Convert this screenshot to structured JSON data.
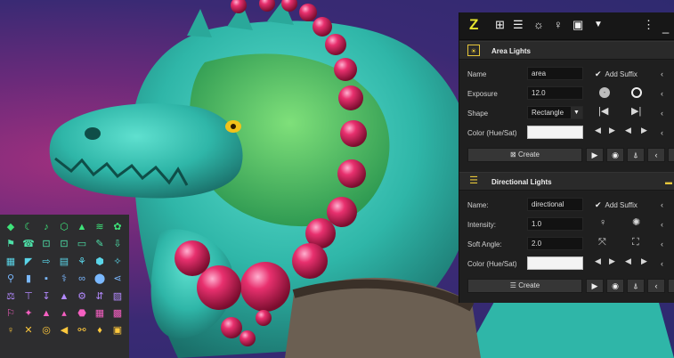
{
  "toolbar": {
    "logo": "Z",
    "icons": [
      "sun-box-icon",
      "list-stack-icon",
      "horizon-sun-icon",
      "bulb-icon",
      "film-icon",
      "chevron-down-icon",
      "more-vertical-icon",
      "minimize-icon"
    ]
  },
  "area": {
    "title": "Area Lights",
    "name_label": "Name",
    "name_value": "area",
    "add_suffix": "Add Suffix",
    "exposure_label": "Exposure",
    "exposure_value": "12.0",
    "shape_label": "Shape",
    "shape_value": "Rectangle",
    "color_label": "Color (Hue/Sat)",
    "color_value": "#f4f4f4",
    "create_label": "Create"
  },
  "directional": {
    "title": "Directional Lights",
    "name_label": "Name:",
    "name_value": "directional",
    "add_suffix": "Add Suffix",
    "intensity_label": "Intensity:",
    "intensity_value": "1.0",
    "soft_label": "Soft Angle:",
    "soft_value": "2.0",
    "color_label": "Color (Hue/Sat)",
    "color_value": "#f4f4f4",
    "create_label": "Create"
  },
  "colors": {
    "accent": "#e6e52f",
    "panel": "#1f1f1f",
    "icon_palette": [
      "#3ee47a",
      "#4de0a8",
      "#5ad5e8",
      "#7ab8ff",
      "#b38aff",
      "#f55fc1",
      "#ffc83d"
    ]
  }
}
